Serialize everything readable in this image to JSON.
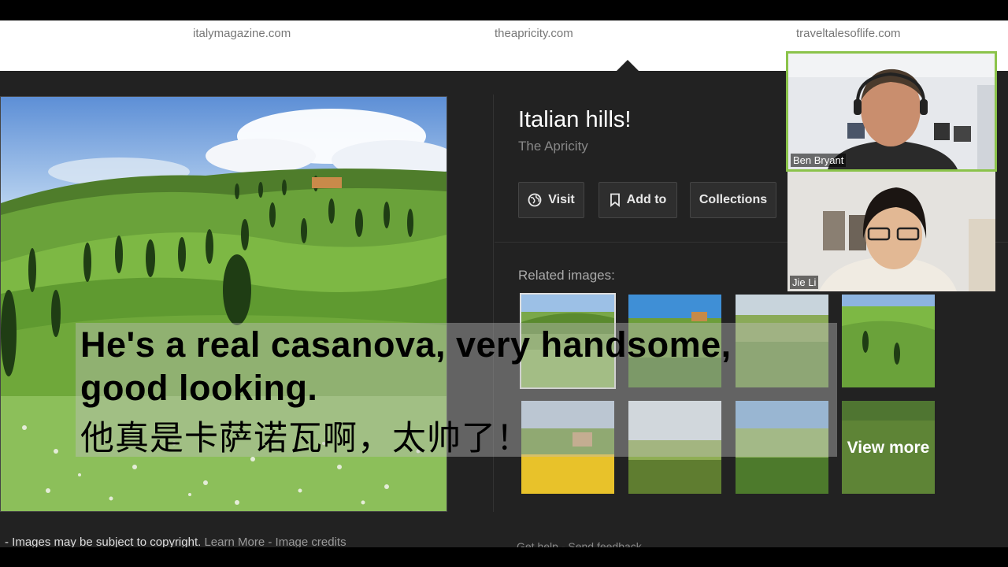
{
  "sources": [
    {
      "label": "italymagazine.com"
    },
    {
      "label": "theapricity.com"
    },
    {
      "label": "traveltalesoflife.com"
    }
  ],
  "image_panel": {
    "title": "Italian hills!",
    "source": "The Apricity",
    "actions": [
      {
        "label": "Visit",
        "icon": "globe-icon"
      },
      {
        "label": "Add to",
        "icon": "bookmark-icon"
      },
      {
        "label": "Collections"
      }
    ],
    "related_label": "Related images:",
    "view_more": "View more"
  },
  "footer": {
    "prefix": "- ",
    "copyright": "Images may be subject to copyright.",
    "learn_more": "Learn More",
    "separator": " - ",
    "image_credits": "Image credits",
    "right_links": "Get help - Send feedback"
  },
  "subtitle": {
    "line1": "He's a real casanova, very handsome,",
    "line2": "good looking.",
    "line3": "他真是卡萨诺瓦啊，太帅了！"
  },
  "participants": [
    {
      "name": "Ben Bryant"
    },
    {
      "name": "Jie Li"
    }
  ],
  "colors": {
    "active_speaker": "#8bc34a",
    "panel_bg": "#222222"
  }
}
